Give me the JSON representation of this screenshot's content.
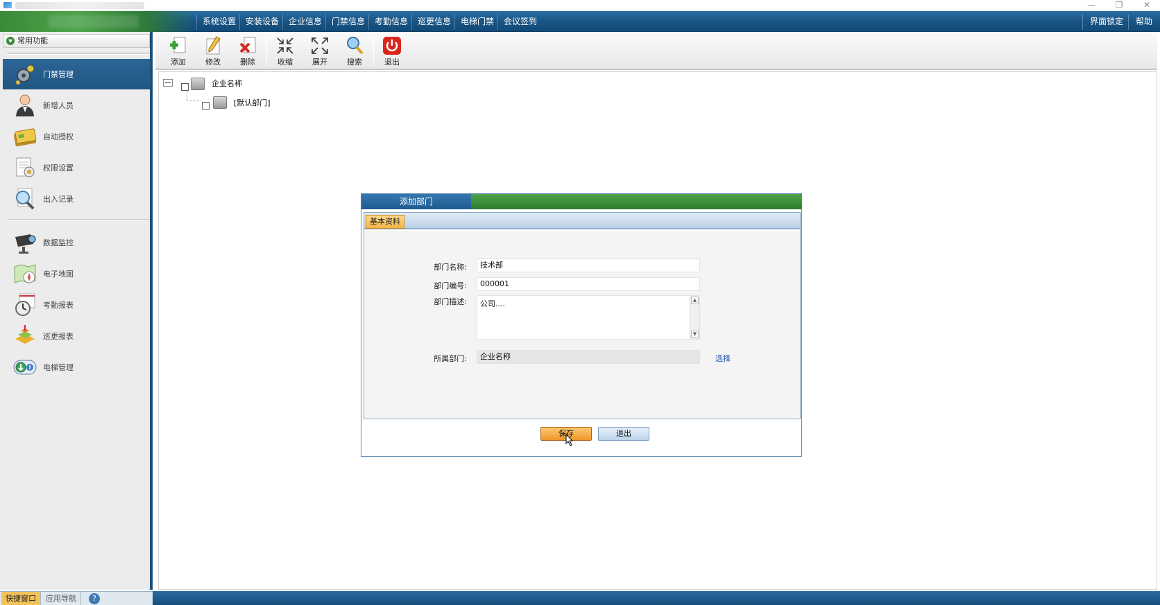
{
  "window": {
    "minimize": "—",
    "restore": "❐",
    "close": "✕"
  },
  "menu": {
    "items": [
      "系统设置",
      "安装设备",
      "企业信息",
      "门禁信息",
      "考勤信息",
      "巡更信息",
      "电梯门禁",
      "会议签到"
    ],
    "right": [
      "界面锁定",
      "帮助"
    ]
  },
  "sidebar": {
    "header": "常用功能",
    "items": [
      {
        "label": "门禁管理",
        "icon": "door-control-icon"
      },
      {
        "label": "新增人员",
        "icon": "person-icon"
      },
      {
        "label": "自动授权",
        "icon": "card-icon"
      },
      {
        "label": "权限设置",
        "icon": "permission-icon"
      },
      {
        "label": "出入记录",
        "icon": "magnifier-icon"
      },
      {
        "label": "数据监控",
        "icon": "camera-icon"
      },
      {
        "label": "电子地图",
        "icon": "map-icon"
      },
      {
        "label": "考勤报表",
        "icon": "clock-icon"
      },
      {
        "label": "巡更报表",
        "icon": "patrol-icon"
      },
      {
        "label": "电梯管理",
        "icon": "elevator-icon"
      }
    ],
    "tabs": [
      "快捷窗口",
      "应用导航"
    ],
    "help": "?"
  },
  "toolbar": {
    "add": "添加",
    "edit": "修改",
    "delete": "删除",
    "collapse": "收缩",
    "expand": "展开",
    "search": "搜索",
    "exit": "退出"
  },
  "tree": {
    "root": "企业名称",
    "child": "[默认部门]"
  },
  "dialog": {
    "title": "添加部门",
    "tab": "基本资料",
    "fields": {
      "name_label": "部门名称:",
      "name_value": "技术部",
      "code_label": "部门编号:",
      "code_value": "000001",
      "desc_label": "部门描述:",
      "desc_value": "公司....",
      "parent_label": "所属部门:",
      "parent_value": "企业名称",
      "select_link": "选择"
    },
    "buttons": {
      "save": "保存",
      "exit": "退出"
    }
  }
}
